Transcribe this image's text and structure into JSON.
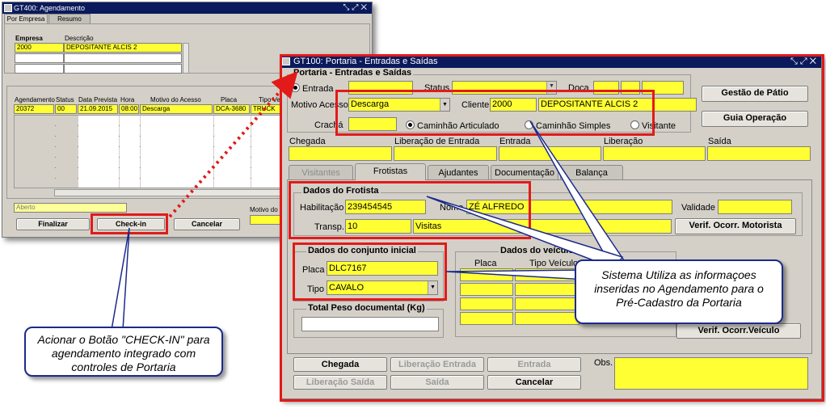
{
  "win1": {
    "title": "GT400: Agendamento",
    "tabs": [
      "Por Empresa",
      "Resumo"
    ],
    "empresa_label": "Empresa",
    "descricao_label": "Descrição",
    "empresa_value": "2000",
    "descricao_value": "DEPOSITANTE ALCIS 2",
    "columns": [
      "Agendamento",
      "Status",
      "Data Prevista",
      "Hora",
      "Motivo do Acesso",
      "Placa",
      "Tipo Veíc"
    ],
    "row": {
      "agendamento": "20372",
      "status": "00",
      "data": "21.09.2015",
      "hora": "08:00",
      "motivo": "Descarga",
      "placa": "DCA-3680",
      "tipo": "TRUCK"
    },
    "status_value": "Aberto",
    "motivo_label": "Motivo do C",
    "finalizar": "Finalizar",
    "checkin": "Check-in",
    "cancelar": "Cancelar"
  },
  "win2": {
    "title": "GT100: Portaria - Entradas e Saídas",
    "section_title": "Portaria - Entradas e Saídas",
    "entrada_label": "Entrada",
    "status_label": "Status",
    "doca_label": "Doca",
    "motivo_label": "Motivo Acesso",
    "motivo_value": "Descarga",
    "cliente_label": "Cliente",
    "cliente_code": "2000",
    "cliente_name": "DEPOSITANTE ALCIS 2",
    "cracha_label": "Crachá",
    "radios": [
      "Caminhão Articulado",
      "Caminhão Simples",
      "Visitante"
    ],
    "btn_gestao": "Gestão de Pátio",
    "btn_guia": "Guia Operação",
    "times": [
      "Chegada",
      "Liberação de Entrada",
      "Entrada",
      "Liberação",
      "Saída"
    ],
    "tabs": [
      "Visitantes",
      "Frotistas",
      "Ajudantes",
      "Documentação",
      "Balança"
    ],
    "frotista": {
      "title": "Dados do Frotista",
      "habilitacao_label": "Habilitação",
      "habilitacao": "239454545",
      "nome_label": "Nome",
      "nome": "ZÉ ALFREDO",
      "validade_label": "Validade",
      "transp_label": "Transp.",
      "transp_code": "10",
      "transp_name": "Visitas",
      "verif_motorista": "Verif. Ocorr. Motorista"
    },
    "conjunto": {
      "title": "Dados do conjunto inicial",
      "placa_label": "Placa",
      "placa": "DLC7167",
      "tipo_label": "Tipo",
      "tipo": "CAVALO"
    },
    "veiculo": {
      "title": "Dados do veículo artic",
      "placa_label": "Placa",
      "tipo_label": "Tipo Veículo",
      "verif": "Verif. Ocorr.Veículo"
    },
    "peso_title": "Total Peso documental (Kg)",
    "buttons": [
      "Chegada",
      "Liberação Entrada",
      "Entrada",
      "Liberação Saída",
      "Saída",
      "Cancelar"
    ],
    "obs_label": "Obs."
  },
  "callout_left": "Acionar o Botão \"CHECK-IN\" para agendamento integrado com controles de Portaria",
  "callout_right": "Sistema Utiliza as informaçoes inseridas no Agendamento para o Pré-Cadastro da Portaria",
  "colors": {
    "title_bar": "#0a1a5c",
    "field_highlight": "#ffff33",
    "annotation_red": "#e21a1a",
    "callout_border": "#1b2a8c",
    "window_bg": "#d4d0c8"
  }
}
